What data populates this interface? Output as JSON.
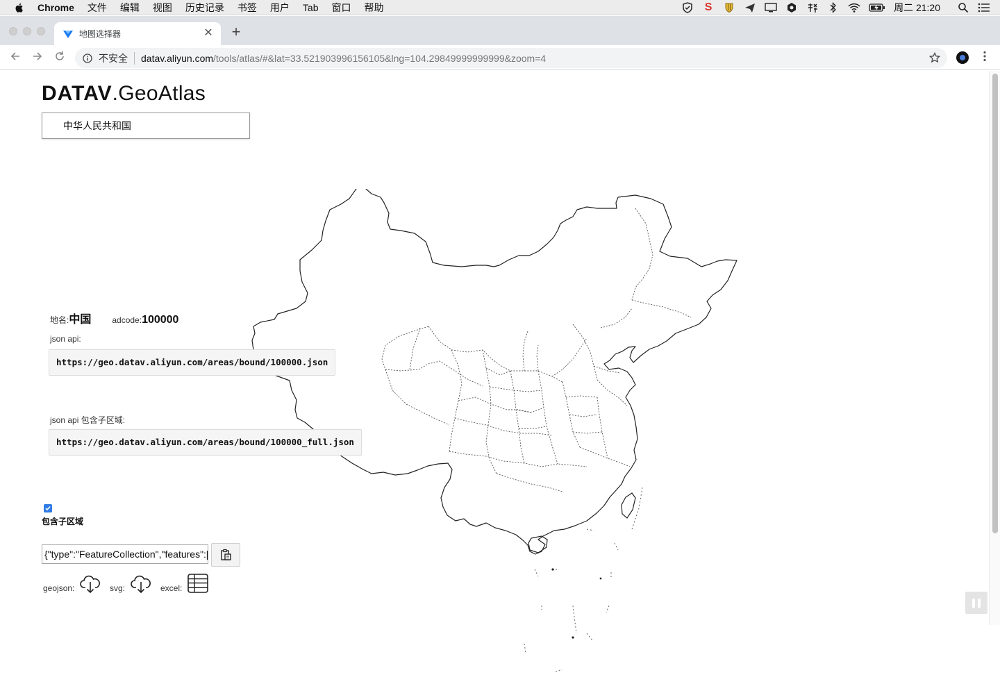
{
  "menubar": {
    "app": "Chrome",
    "items": [
      "文件",
      "编辑",
      "视图",
      "历史记录",
      "书签",
      "用户",
      "Tab",
      "窗口",
      "帮助"
    ],
    "clock": "周二 21:20",
    "status_s": "S"
  },
  "browser": {
    "tab_title": "地图选择器",
    "close_glyph": "✕",
    "new_tab_glyph": "+",
    "security_label": "不安全",
    "url_host": "datav.aliyun.com",
    "url_path": "/tools/atlas/#&lat=33.521903996156105&lng=104.29849999999999&zoom=4"
  },
  "page": {
    "logo_strong": "DATAV",
    "logo_light": ".GeoAtlas",
    "region_select_value": "中华人民共和国",
    "name_label": "地名:",
    "name_value": "中国",
    "adcode_label": "adcode:",
    "adcode_value": "100000",
    "json_api_label": "json api:",
    "json_api_url": "https://geo.datav.aliyun.com/areas/bound/100000.json",
    "json_api_full_label": "json api 包含子区域:",
    "json_api_full_url": "https://geo.datav.aliyun.com/areas/bound/100000_full.json",
    "include_children_checked": true,
    "include_children_label": "包含子区域",
    "json_field_value": "{\"type\":\"FeatureCollection\",\"features\":[",
    "geojson_label": "geojson:",
    "svg_label": "svg:",
    "excel_label": "excel:"
  },
  "colors": {
    "checkbox_accent": "#2f7be5",
    "map_stroke": "#222222",
    "map_inner_stroke": "#555555"
  }
}
